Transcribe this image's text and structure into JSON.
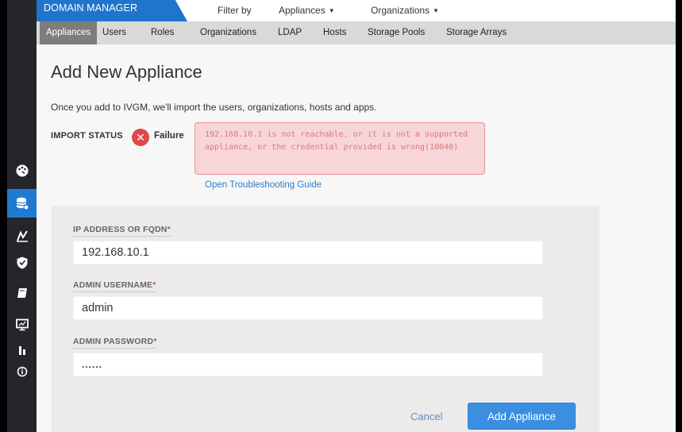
{
  "header": {
    "brand": "DOMAIN MANAGER",
    "filter_label": "Filter by",
    "appliances_menu": "Appliances",
    "organizations_menu": "Organizations"
  },
  "nav": {
    "tabs": [
      {
        "label": "Appliances",
        "active": true
      },
      {
        "label": "Users"
      },
      {
        "label": "Roles"
      },
      {
        "label": "Organizations"
      },
      {
        "label": "LDAP"
      },
      {
        "label": "Hosts"
      },
      {
        "label": "Storage Pools"
      },
      {
        "label": "Storage Arrays"
      }
    ]
  },
  "sidebar": {
    "icons": [
      "dashboard-icon",
      "database-icon",
      "analytics-icon",
      "shield-icon",
      "book-icon",
      "monitor-icon",
      "bars-icon",
      "info-icon"
    ],
    "active": "database-icon",
    "accent": "#1f7bd0"
  },
  "page": {
    "title": "Add New Appliance",
    "intro": "Once you add to IVGM, we'll import the users, organizations, hosts and apps.",
    "import_status_label": "IMPORT STATUS",
    "status": "Failure",
    "error_message": "192.168.10.1 is not reachable, or it is not a supported appliance, or the credential provided is wrong(10040)",
    "troubleshoot_link": "Open Troubleshooting Guide"
  },
  "form": {
    "ip_label": "IP ADDRESS OR FQDN",
    "ip_value": "192.168.10.1",
    "username_label": "ADMIN USERNAME",
    "username_value": "admin",
    "password_label": "ADMIN PASSWORD",
    "password_value": "......",
    "required_mark": "*",
    "cancel_label": "Cancel",
    "submit_label": "Add Appliance"
  },
  "colors": {
    "brand": "#1f75cb",
    "failure": "#e0474c",
    "primary_button": "#3b8ee0"
  }
}
